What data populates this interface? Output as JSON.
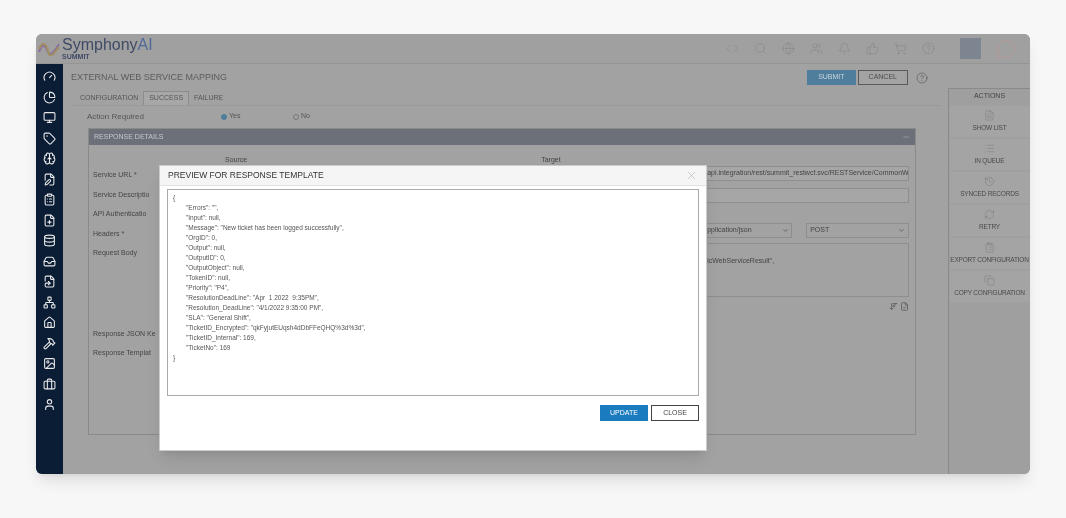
{
  "header": {
    "brand": "Symphony",
    "brand_suffix": "AI",
    "brand_sub": "SUMMIT"
  },
  "page": {
    "title": "EXTERNAL WEB SERVICE MAPPING",
    "buttons": [
      {
        "label": "SUBMIT",
        "kind": "primary"
      },
      {
        "label": "CANCEL",
        "kind": "secondary"
      }
    ]
  },
  "tabs": [
    {
      "label": "CONFIGURATION",
      "selected": false
    },
    {
      "label": "SUCCESS",
      "selected": true
    },
    {
      "label": "FAILURE",
      "selected": false
    }
  ],
  "action_required": {
    "label": "Action Required",
    "options": [
      {
        "label": "Yes",
        "selected": true
      },
      {
        "label": "No",
        "selected": false
      }
    ]
  },
  "response_details": {
    "title": "RESPONSE DETAILS",
    "source_heading": "Source",
    "target_heading": "Target",
    "labels": [
      "Service URL *",
      "Service Descriptio",
      "API Authenticatio",
      "Headers *",
      "Request Body",
      "Response JSON Ke",
      "Response Templat"
    ],
    "service_url": "api.integration/rest/summit_restwcf.svc/RESTService/CommonW",
    "content_type": "pplication/json",
    "method": "POST",
    "request_body": "icWebServiceResult\","
  },
  "actions": {
    "title": "ACTIONS",
    "items": [
      "SHOW LIST",
      "IN QUEUE",
      "SYNCED RECORDS",
      "RETRY",
      "EXPORT CONFIGURATION",
      "COPY CONFIGURATION"
    ]
  },
  "modal": {
    "title": "PREVIEW FOR RESPONSE TEMPLATE",
    "open": "{",
    "close": "}",
    "entries": [
      "\"Errors\": \"\",",
      "\"Input\": null,",
      "\"Message\": \"New ticket has been logged successfully\",",
      "\"OrgID\": 0,",
      "\"Output\": null,",
      "\"OutputID\": 0,",
      "\"OutputObject\": null,",
      "\"TokenID\": null,",
      "\"Priority\": \"P4\",",
      "\"ResolutionDeadLine\": \"Apr  1 2022  9:35PM\",",
      "\"Resolution_DeadLine\": \"4/1/2022 9:35:00 PM\",",
      "\"SLA\": \"General Shift\",",
      "\"TicketID_Encrypted\": \"qkFyjutEUqsh4dDbFFeQHQ%3d%3d\",",
      "\"TicketID_Internal\": 169,",
      "\"TicketNo\": 169"
    ],
    "buttons": [
      {
        "label": "UPDATE",
        "kind": "primary"
      },
      {
        "label": "CLOSE",
        "kind": "secondary"
      }
    ]
  }
}
